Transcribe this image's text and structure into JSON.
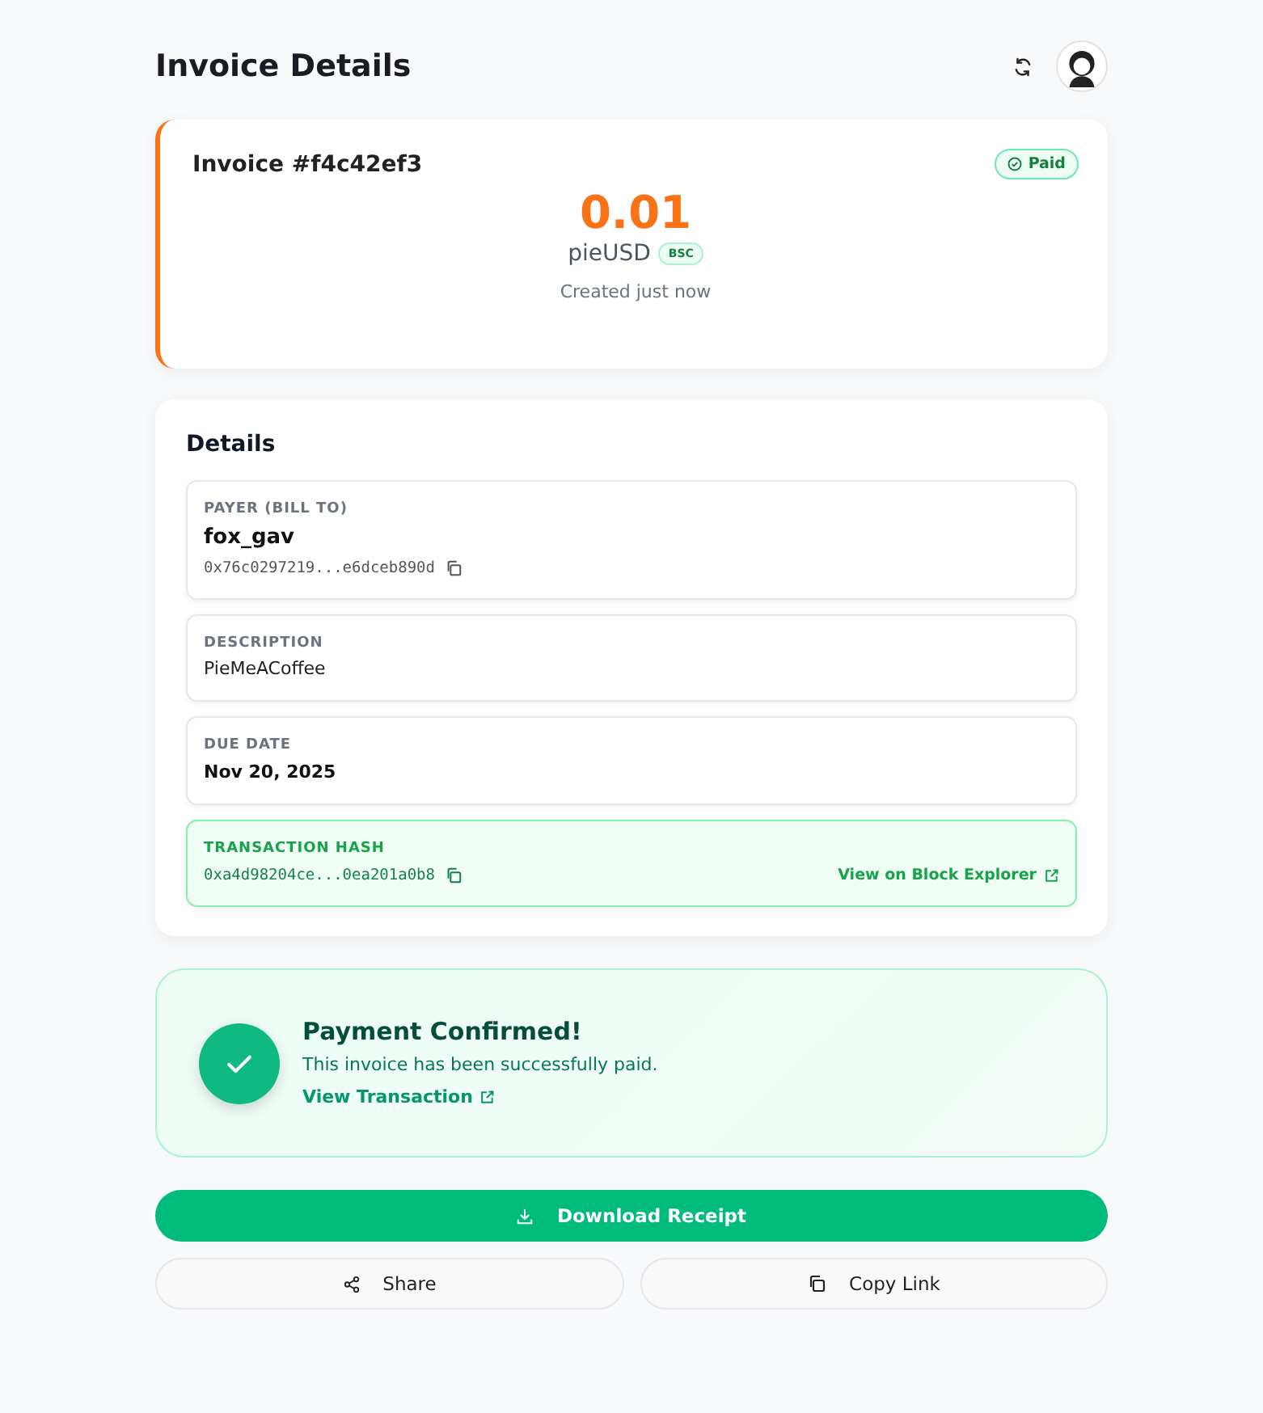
{
  "page": {
    "title": "Invoice Details"
  },
  "invoice": {
    "title": "Invoice #f4c42ef3",
    "status": {
      "kind": "paid",
      "label": "Paid"
    },
    "amount": "0.01",
    "token": "pieUSD",
    "network": "BSC",
    "created": "Created just now"
  },
  "details": {
    "title": "Details",
    "fields": [
      {
        "kind": "party",
        "label": "PAYER (BILL TO)",
        "value": "fox_gav",
        "address": "0x76c0297219...e6dceb890d"
      },
      {
        "kind": "text",
        "label": "DESCRIPTION",
        "value": "PieMeACoffee"
      },
      {
        "kind": "date",
        "label": "DUE DATE",
        "value": "Nov 20, 2025"
      },
      {
        "kind": "hash",
        "label": "TRANSACTION HASH",
        "address": "0xa4d98204ce...0ea201a0b8",
        "link": "View on Block Explorer"
      }
    ]
  },
  "confirmation": {
    "title": "Payment Confirmed!",
    "message": "This invoice has been successfully paid.",
    "link": "View Transaction"
  },
  "actions": {
    "primary": "Download Receipt",
    "secondary": [
      {
        "kind": "share",
        "label": "Share"
      },
      {
        "kind": "copy",
        "label": "Copy Link"
      }
    ]
  }
}
